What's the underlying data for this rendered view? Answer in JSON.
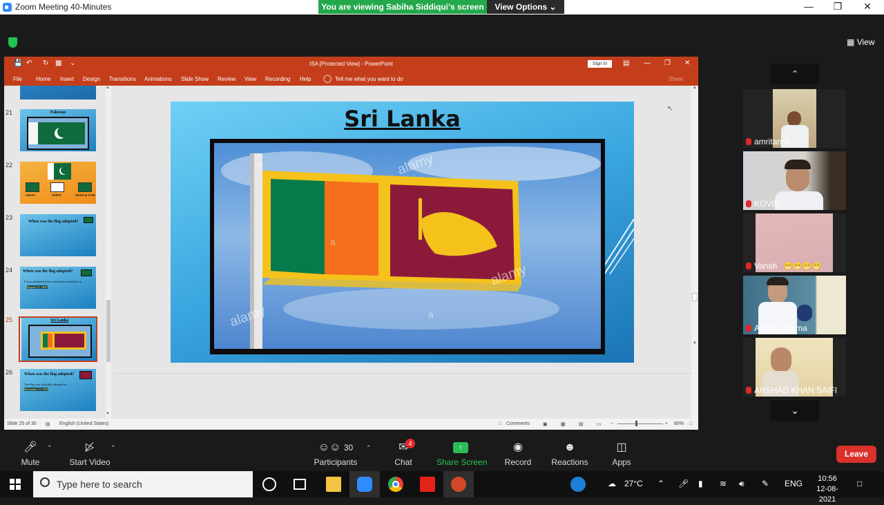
{
  "zoom": {
    "window_title": "Zoom Meeting 40-Minutes",
    "viewing_banner": "You are viewing Sabiha Siddiqui's screen",
    "view_options": "View Options",
    "view_button": "View",
    "toolbar": {
      "mute": "Mute",
      "start_video": "Start Video",
      "participants": "Participants",
      "participants_count": "30",
      "chat": "Chat",
      "chat_badge": "4",
      "share_screen": "Share Screen",
      "record": "Record",
      "reactions": "Reactions",
      "apps": "Apps",
      "leave": "Leave"
    },
    "participants": [
      {
        "name": "amritansh"
      },
      {
        "name": "KOVID"
      },
      {
        "name": "Vansh"
      },
      {
        "name": "Aman Sharma"
      },
      {
        "name": "ARSHAD KHAN SAIFI"
      }
    ],
    "vansh_reactions": "😁😁😁😁"
  },
  "powerpoint": {
    "title": "ISA [Protected View]  -  PowerPoint",
    "sign_in": "Sign in",
    "ribbon_tabs": [
      "File",
      "Home",
      "Insert",
      "Design",
      "Transitions",
      "Animations",
      "Slide Show",
      "Review",
      "View",
      "Recording",
      "Help"
    ],
    "tell_me": "Tell me what you want to do",
    "share": "Share",
    "thumbnails": [
      {
        "num": "21",
        "title": "Pakistan"
      },
      {
        "num": "22",
        "labels": [
          "GREEN",
          "WHITE",
          "MOON & STAR"
        ]
      },
      {
        "num": "23",
        "title": "When was the flag adopted?"
      },
      {
        "num": "24",
        "title": "When was the flag adopted?",
        "text": "It was adopted by the constituent assembly on",
        "highlight": "August 11, 1947"
      },
      {
        "num": "25",
        "title": "Sri Lanka"
      },
      {
        "num": "26",
        "title": "When was the flag adopted?",
        "text": "The flag was officially adopted on",
        "highlight": "December 17, 1978"
      }
    ],
    "slide": {
      "title": "Sri Lanka",
      "watermarks": [
        "a",
        "alamy",
        "a",
        "alamy",
        "alamy",
        "a"
      ]
    },
    "status": {
      "slide_info": "Slide 25 of 30",
      "language": "English (United States)",
      "comments": "Comments",
      "zoom": "80%"
    }
  },
  "taskbar": {
    "search_placeholder": "Type here to search",
    "temperature": "27°C",
    "language": "ENG",
    "time": "10:56",
    "date": "12-08-2021"
  }
}
